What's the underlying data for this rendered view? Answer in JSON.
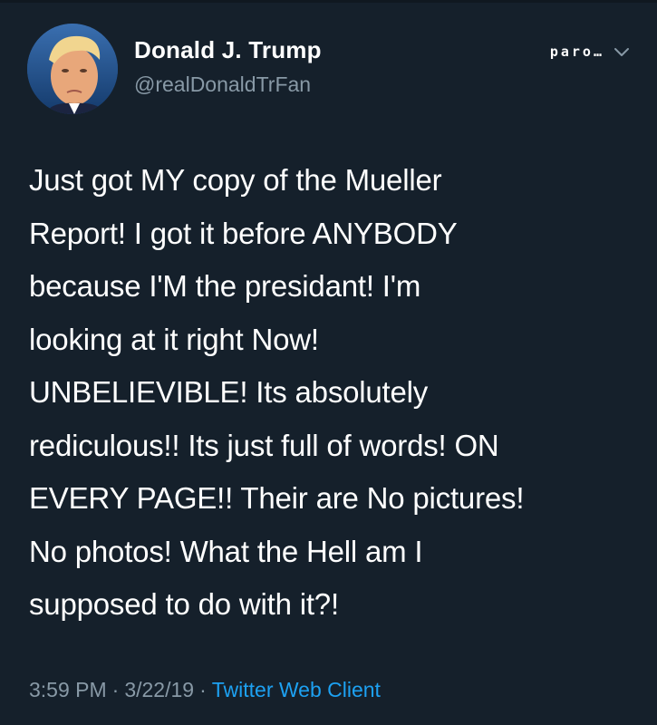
{
  "author": {
    "display_name": "Donald J. Trump",
    "handle": "@realDonaldTrFan",
    "label": "paro…",
    "avatar_icon": "profile-photo-icon"
  },
  "tweet": {
    "text": "Just got MY copy of the Mueller\nReport! I got it before ANYBODY\nbecause I'M the presidant! I'm\nlooking at it right Now!\nUNBELIEVIBLE! Its absolutely\nrediculous!! Its just full of words! ON\nEVERY PAGE!! Their are No pictures!\nNo photos! What the Hell am I\nsupposed to do with it?!"
  },
  "meta": {
    "time": "3:59 PM",
    "separator": "·",
    "date": "3/22/19",
    "source": "Twitter Web Client"
  },
  "colors": {
    "background": "#15202b",
    "text": "#ffffff",
    "muted": "#8899a6",
    "link": "#1da1f2"
  },
  "icons": {
    "menu": "chevron-down-icon"
  }
}
